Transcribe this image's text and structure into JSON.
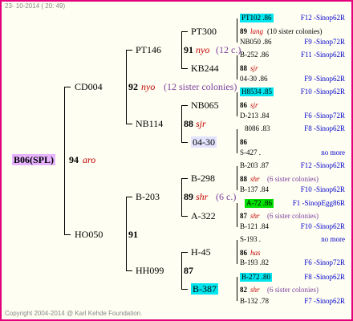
{
  "header_date": "23- 10-2014 ( 20: 49)",
  "footer": "Copyright 2004-2014 @ Karl Kehde Foundation.",
  "gen0": {
    "id": "B06(SPL)",
    "score": "94",
    "race": "aro"
  },
  "gen1": [
    {
      "id": "CD004",
      "score": "92",
      "race": "nyo",
      "note": "(12 sister colonies)"
    },
    {
      "id": "HO050",
      "score": "91"
    }
  ],
  "gen2": [
    {
      "id": "PT146",
      "score": "91",
      "race": "nyo",
      "note": "(12 c.)"
    },
    {
      "id": "NB114",
      "score": "88",
      "race": "sjr"
    },
    {
      "id": "B-203",
      "score": "89",
      "race": "shr",
      "note": "(6 c.)"
    },
    {
      "id": "HH099",
      "score": "87"
    }
  ],
  "gen3": [
    {
      "id": "PT300",
      "score": "89",
      "race": "lang",
      "note": "(10 sister colonies)"
    },
    {
      "id": "KB244",
      "score": "88",
      "race": "sjr"
    },
    {
      "id": "NB065",
      "score": "86",
      "race": "sjr"
    },
    {
      "id": "04-30",
      "score": "86"
    },
    {
      "id": "B-298",
      "score": "88",
      "race": "shr",
      "note": "(6 sister colonies)"
    },
    {
      "id": "A-322",
      "score": "87",
      "race": "shr",
      "note": "(6 sister colonies)"
    },
    {
      "id": "H-45",
      "score": "86",
      "race": "has"
    },
    {
      "id": "B-387",
      "score": "82",
      "race": "shr",
      "note": "(6 sister colonies)"
    }
  ],
  "gen4": [
    {
      "id": "PT102 .86",
      "link": "F12 -Sinop62R"
    },
    {
      "id": "NB050 .86",
      "link": "F9 -Sinop72R"
    },
    {
      "id": "B-252 .86",
      "link": "F11 -Sinop62R"
    },
    {
      "id": "04-30 .86",
      "link": "F9 -Sinop62R"
    },
    {
      "id": "H8534 .85",
      "link": "F10 -Sinop62R"
    },
    {
      "id": "D-213 .84",
      "link": "F6 -Sinop72R"
    },
    {
      "id": "8086 .83",
      "link": "F8 -Sinop62R"
    },
    {
      "id": "S-427 .",
      "link": "no more"
    },
    {
      "id": "B-203 .87",
      "link": "F12 -Sinop62R"
    },
    {
      "id": "B-137 .84",
      "link": "F10 -Sinop62R"
    },
    {
      "id": "A-72 .86",
      "link": "F1 -SinopEgg86R"
    },
    {
      "id": "B-121 .84",
      "link": "F10 -Sinop62R"
    },
    {
      "id": "S-193 .",
      "link": "no more"
    },
    {
      "id": "B-193 .82",
      "link": "F6 -Sinop72R"
    },
    {
      "id": "B-272 .80",
      "link": "F8 -Sinop62R"
    },
    {
      "id": "B-132 .78",
      "link": "F7 -Sinop62R"
    }
  ]
}
